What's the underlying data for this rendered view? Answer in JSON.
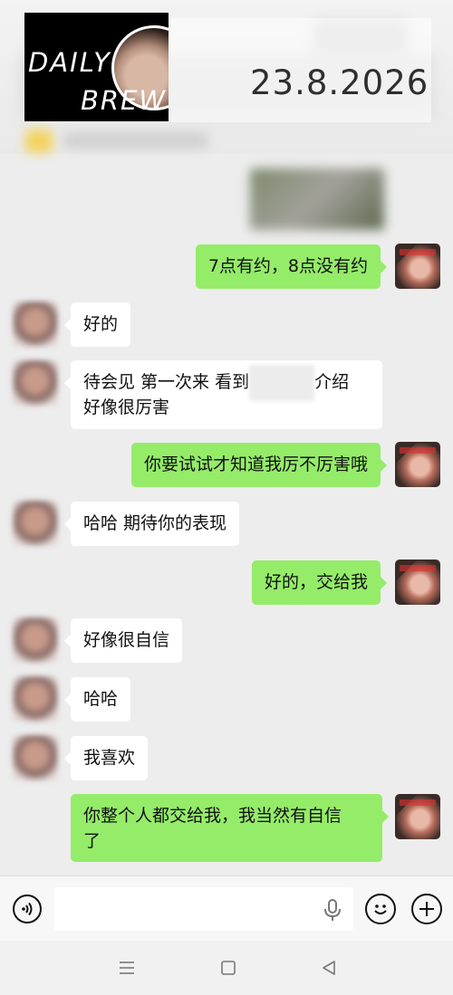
{
  "overlay": {
    "logo_line1": "DAILY",
    "logo_line2": "BREW",
    "date": "23.8.2026"
  },
  "messages": [
    {
      "side": "out",
      "text": "7点有约，8点没有约"
    },
    {
      "side": "in",
      "text": "好的"
    },
    {
      "side": "in",
      "text_part1": "待会见 第一次来 看到",
      "text_part2": "介绍",
      "text_line2": "好像很厉害"
    },
    {
      "side": "out",
      "text": "你要试试才知道我厉不厉害哦"
    },
    {
      "side": "in",
      "text": "哈哈 期待你的表现"
    },
    {
      "side": "out",
      "text": "好的，交给我"
    },
    {
      "side": "in",
      "text": "好像很自信"
    },
    {
      "side": "in",
      "text": "哈哈"
    },
    {
      "side": "in",
      "text": "我喜欢"
    },
    {
      "side": "out",
      "text_line1": "你整个人都交给我，我当然有自信",
      "text_line2": "了"
    }
  ],
  "input_bar": {
    "voice_icon": "voice-icon",
    "mic_icon": "mic-icon",
    "emoji_icon": "emoji-icon",
    "plus_icon": "plus-icon",
    "value": ""
  },
  "nav": {
    "menu_icon": "menu-icon",
    "home_icon": "home-icon",
    "back_icon": "back-icon"
  },
  "colors": {
    "background": "#ededed",
    "outgoing_bubble": "#95ec69",
    "incoming_bubble": "#ffffff"
  }
}
